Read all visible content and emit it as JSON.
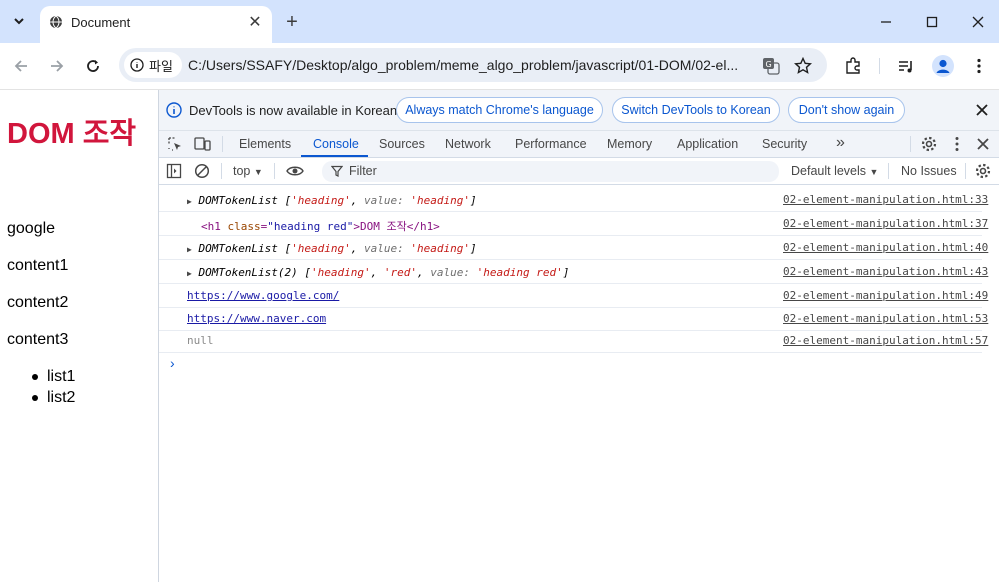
{
  "browser": {
    "tab_title": "Document",
    "new_tab": "+",
    "tab_close": "✕",
    "info_chip_label": "파일",
    "url": "C:/Users/SSAFY/Desktop/algo_problem/meme_algo_problem/javascript/01-DOM/02-el..."
  },
  "page": {
    "heading": "DOM 조작",
    "paragraphs": [
      "google",
      "content1",
      "content2",
      "content3"
    ],
    "list": [
      "list1",
      "list2"
    ]
  },
  "devtools": {
    "infobar": {
      "text": "DevTools is now available in Korean!",
      "btn_match": "Always match Chrome's language",
      "btn_switch": "Switch DevTools to Korean",
      "btn_dismiss": "Don't show again"
    },
    "tabs": [
      "Elements",
      "Console",
      "Sources",
      "Network",
      "Performance",
      "Memory",
      "Application",
      "Security"
    ],
    "active_tab": "Console",
    "more_tabs": "»",
    "console_toolbar": {
      "context": "top",
      "filter_placeholder": "Filter",
      "levels": "Default levels",
      "issues": "No Issues"
    },
    "logs": [
      {
        "src": "02-element-manipulation.html:33",
        "type": "DOMTokenList",
        "items": [
          "'heading'"
        ],
        "value_key": "value:",
        "value": "'heading'"
      },
      {
        "src": "02-element-manipulation.html:37",
        "tag_open": "<h1",
        "attr_name": "class",
        "attr_value": "\"heading red\"",
        "inner": ">DOM 조작</h1>"
      },
      {
        "src": "02-element-manipulation.html:40",
        "type": "DOMTokenList",
        "items": [
          "'heading'"
        ],
        "value_key": "value:",
        "value": "'heading'"
      },
      {
        "src": "02-element-manipulation.html:43",
        "type": "DOMTokenList(2)",
        "items": [
          "'heading'",
          "'red'"
        ],
        "value_key": "value:",
        "value": "'heading red'"
      },
      {
        "src": "02-element-manipulation.html:49",
        "text": "https://www.google.com/"
      },
      {
        "src": "02-element-manipulation.html:53",
        "text": "https://www.naver.com"
      },
      {
        "src": "02-element-manipulation.html:57",
        "text": "null"
      }
    ],
    "prompt": "›"
  },
  "colors": {
    "heading": "#d1163c",
    "accent": "#0b57d0",
    "tabstrip": "#d3e3fd"
  }
}
